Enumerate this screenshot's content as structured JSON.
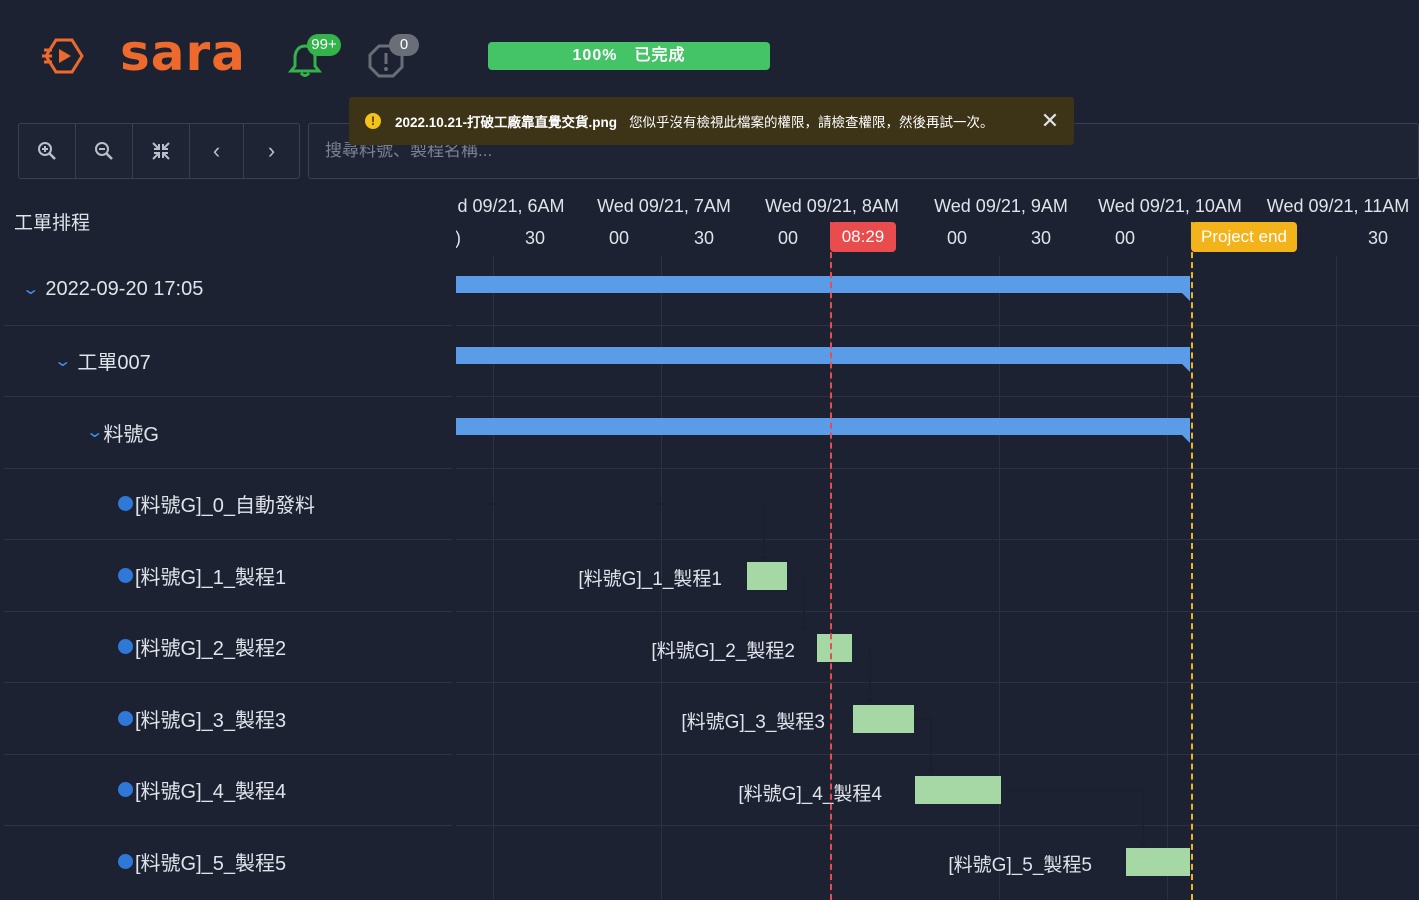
{
  "app": {
    "logo_text": "sara"
  },
  "header": {
    "notification_count": "99+",
    "alert_count": "0",
    "progress_text": "100%　已完成"
  },
  "toast": {
    "filename": "2022.10.21-打破工廠靠直覺交貨.png",
    "message": "您似乎沒有檢視此檔案的權限，請檢查權限，然後再試一次。",
    "close_label": "✕"
  },
  "toolbar": {
    "zoom_in": "⊕",
    "zoom_out": "⊖",
    "fit": "⤧",
    "prev": "‹",
    "next": "›"
  },
  "search": {
    "placeholder": "搜尋料號、製程名稱..."
  },
  "tree": {
    "header": "工單排程",
    "rows": [
      {
        "label": "2022-09-20 17:05"
      },
      {
        "label": "工單007"
      },
      {
        "label": "料號G"
      },
      {
        "label": "[料號G]_0_自動發料"
      },
      {
        "label": "[料號G]_1_製程1"
      },
      {
        "label": "[料號G]_2_製程2"
      },
      {
        "label": "[料號G]_3_製程3"
      },
      {
        "label": "[料號G]_4_製程4"
      },
      {
        "label": "[料號G]_5_製程5"
      }
    ]
  },
  "timeline": {
    "hours": [
      "d 09/21, 6AM",
      "Wed 09/21, 7AM",
      "Wed 09/21, 8AM",
      "Wed 09/21, 9AM",
      "Wed 09/21, 10AM",
      "Wed 09/21, 11AM"
    ],
    "ticks": [
      ")",
      "30",
      "00",
      "30",
      "00",
      "08:29",
      "00",
      "30",
      "00",
      "",
      "30"
    ],
    "today_label": "08:29",
    "end_label": "Project end",
    "task_labels": [
      "[料號G]_1_製程1",
      "[料號G]_2_製程2",
      "[料號G]_3_製程3",
      "[料號G]_4_製程4",
      "[料號G]_5_製程5"
    ]
  }
}
